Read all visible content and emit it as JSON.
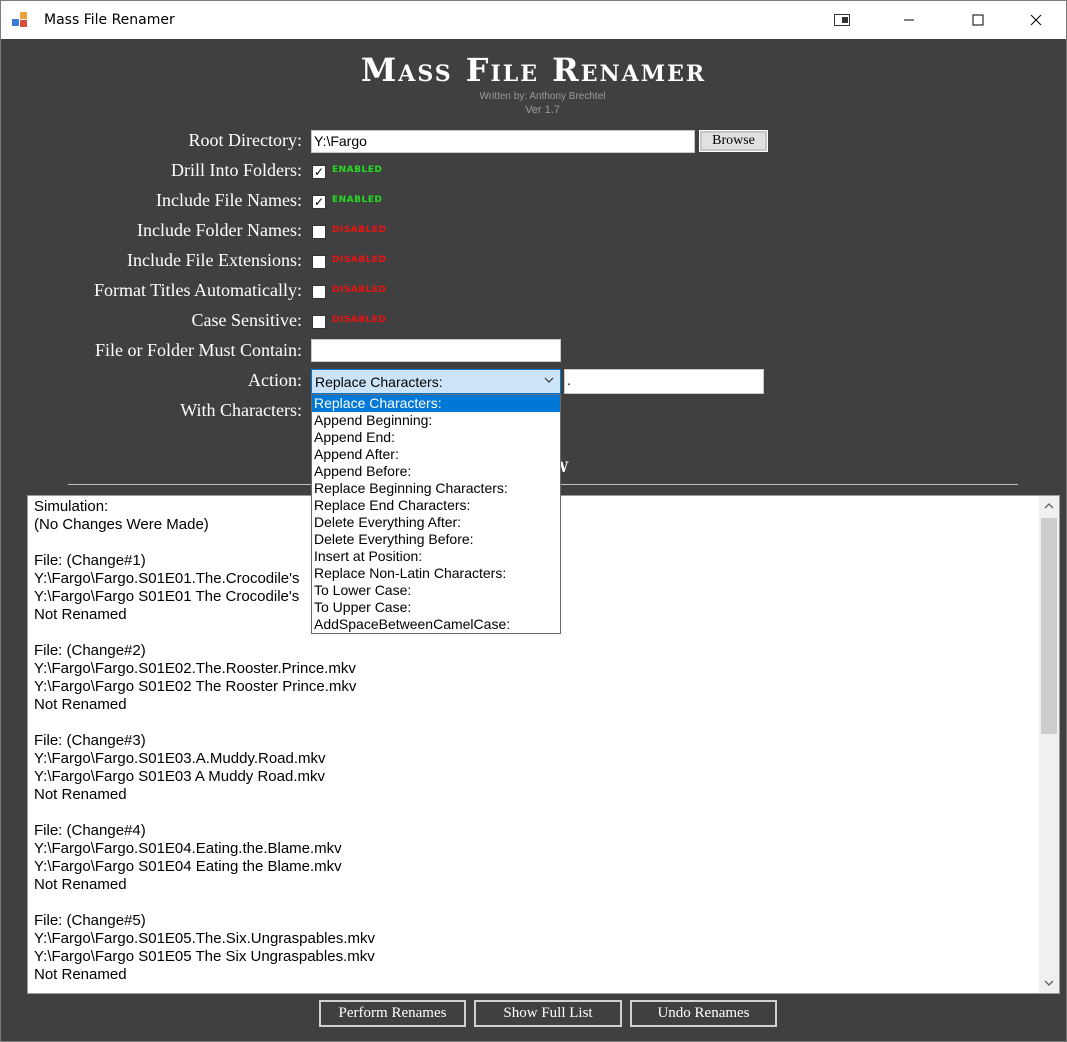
{
  "window": {
    "title": "Mass File Renamer"
  },
  "header": {
    "title": "Mass File Renamer",
    "author": "Written by: Anthony Brechtel",
    "version": "Ver 1.7"
  },
  "form": {
    "root_directory": {
      "label": "Root Directory:",
      "value": "Y:\\Fargo",
      "browse_label": "Browse"
    },
    "options": [
      {
        "label": "Drill Into Folders:",
        "checked": true,
        "state": "Enabled"
      },
      {
        "label": "Include File Names:",
        "checked": true,
        "state": "Enabled"
      },
      {
        "label": "Include Folder Names:",
        "checked": false,
        "state": "Disabled"
      },
      {
        "label": "Include File Extensions:",
        "checked": false,
        "state": "Disabled"
      },
      {
        "label": "Format Titles Automatically:",
        "checked": false,
        "state": "Disabled"
      },
      {
        "label": "Case Sensitive:",
        "checked": false,
        "state": "Disabled"
      }
    ],
    "must_contain": {
      "label": "File or Folder Must Contain:",
      "value": ""
    },
    "action": {
      "label": "Action:",
      "selected": "Replace Characters:",
      "param_value": ".",
      "options": [
        "Replace Characters:",
        "Append Beginning:",
        "Append End:",
        "Append After:",
        "Append Before:",
        "Replace Beginning Characters:",
        "Replace End Characters:",
        "Delete Everything After:",
        "Delete Everything Before:",
        "Insert at Position:",
        "Replace Non-Latin Characters:",
        "To Lower Case:",
        "To Upper Case:",
        "AddSpaceBetweenCamelCase:"
      ]
    },
    "with_characters": {
      "label": "With Characters:"
    }
  },
  "preview": {
    "title_visible": "ew",
    "lines": [
      "Simulation:",
      "(No Changes Were Made)",
      "",
      "File: (Change#1)",
      "Y:\\Fargo\\Fargo.S01E01.The.Crocodile's",
      "Y:\\Fargo\\Fargo S01E01 The Crocodile's",
      "Not Renamed",
      "",
      "File: (Change#2)",
      "Y:\\Fargo\\Fargo.S01E02.The.Rooster.Prince.mkv",
      "Y:\\Fargo\\Fargo S01E02 The Rooster Prince.mkv",
      "Not Renamed",
      "",
      "File: (Change#3)",
      "Y:\\Fargo\\Fargo.S01E03.A.Muddy.Road.mkv",
      "Y:\\Fargo\\Fargo S01E03 A Muddy Road.mkv",
      "Not Renamed",
      "",
      "File: (Change#4)",
      "Y:\\Fargo\\Fargo.S01E04.Eating.the.Blame.mkv",
      "Y:\\Fargo\\Fargo S01E04 Eating the Blame.mkv",
      "Not Renamed",
      "",
      "File: (Change#5)",
      "Y:\\Fargo\\Fargo.S01E05.The.Six.Ungraspables.mkv",
      "Y:\\Fargo\\Fargo S01E05 The Six Ungraspables.mkv",
      "Not Renamed"
    ]
  },
  "buttons": {
    "perform": "Perform Renames",
    "show_full": "Show Full List",
    "undo": "Undo Renames"
  },
  "colors": {
    "background": "#404040",
    "enabled": "#22dd22",
    "disabled": "#ee1111",
    "accent": "#0078d7"
  }
}
